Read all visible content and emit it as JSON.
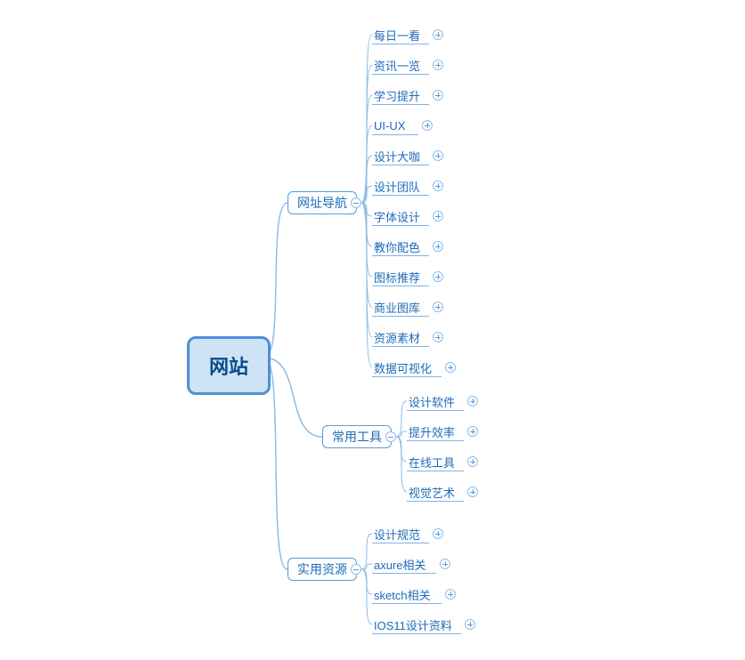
{
  "root": {
    "label": "网站"
  },
  "categories": [
    {
      "id": "nav",
      "label": "网址导航",
      "leaves": [
        {
          "label": "每日一看"
        },
        {
          "label": "资讯一览"
        },
        {
          "label": "学习提升"
        },
        {
          "label": "UI-UX"
        },
        {
          "label": "设计大咖"
        },
        {
          "label": "设计团队"
        },
        {
          "label": "字体设计"
        },
        {
          "label": "教你配色"
        },
        {
          "label": "图标推荐"
        },
        {
          "label": "商业图库"
        },
        {
          "label": "资源素材"
        },
        {
          "label": "数据可视化"
        }
      ]
    },
    {
      "id": "tools",
      "label": "常用工具",
      "leaves": [
        {
          "label": "设计软件"
        },
        {
          "label": "提升效率"
        },
        {
          "label": "在线工具"
        },
        {
          "label": "视觉艺术"
        }
      ]
    },
    {
      "id": "res",
      "label": "实用资源",
      "leaves": [
        {
          "label": "设计规范"
        },
        {
          "label": "axure相关"
        },
        {
          "label": "sketch相关"
        },
        {
          "label": "IOS11设计资料"
        }
      ]
    }
  ]
}
